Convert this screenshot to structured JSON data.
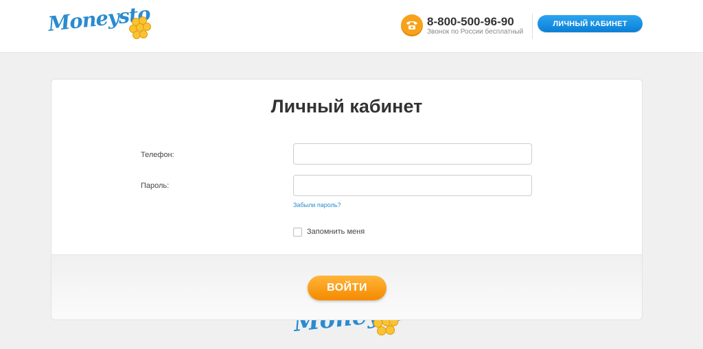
{
  "header": {
    "logo_text": "Moneysto",
    "phone_number": "8-800-500-96-90",
    "phone_note": "Звонок по России бесплатный",
    "cabinet_button": "ЛИЧНЫЙ КАБИНЕТ"
  },
  "login_form": {
    "title": "Личный кабинет",
    "phone_label": "Телефон:",
    "phone_value": "",
    "password_label": "Пароль:",
    "password_value": "",
    "forgot_link": "Забыли пароль?",
    "remember_label": "Запомнить меня",
    "remember_checked": false,
    "submit_button": "ВОЙТИ"
  },
  "background": {
    "logo_text": "Moneysto"
  },
  "colors": {
    "brand_blue": "#2a8bd0",
    "accent_orange": "#f7a21b",
    "page_background": "#f0f0f0"
  },
  "icons": [
    "phone-icon",
    "coins-icon",
    "checkbox-icon"
  ]
}
